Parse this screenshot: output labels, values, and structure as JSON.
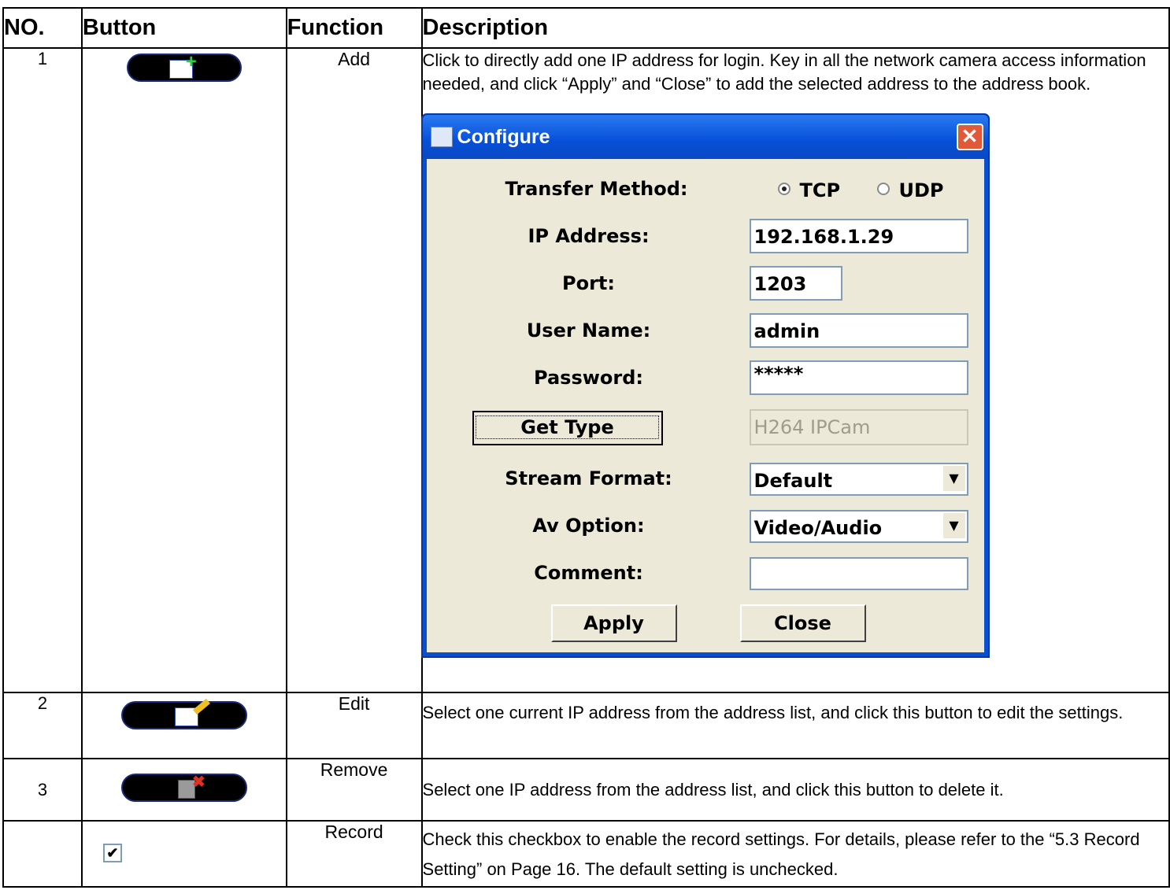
{
  "headers": {
    "no": "NO.",
    "button": "Button",
    "function": "Function",
    "description": "Description"
  },
  "rows": [
    {
      "no": "1",
      "function": "Add",
      "description": "Click to directly add one IP address for login. Key in all the network camera access information needed, and click “Apply” and “Close” to add the selected address to the address book.",
      "icon": "add-icon"
    },
    {
      "no": "2",
      "function": "Edit",
      "description": "Select one current IP address from the address list, and click this button to edit the settings.",
      "icon": "edit-icon"
    },
    {
      "no": "3",
      "function": "Remove",
      "description": "Select one IP address from the address list, and click this button to delete it.",
      "icon": "delete-icon"
    },
    {
      "no": "",
      "function": "Record",
      "description": "Check this checkbox to enable the record settings. For details, please refer to the “5.3 Record Setting” on Page 16. The default setting is unchecked.",
      "icon": "checkbox-icon"
    }
  ],
  "dialog": {
    "title": "Configure",
    "close": "✕",
    "transfer_method_label": "Transfer Method:",
    "tcp": "TCP",
    "udp": "UDP",
    "ip_label": "IP Address:",
    "ip_value": "192.168.1.29",
    "port_label": "Port:",
    "port_value": "1203",
    "user_label": "User Name:",
    "user_value": "admin",
    "password_label": "Password:",
    "password_value": "*****",
    "get_type_button": "Get Type",
    "type_value": "H264 IPCam",
    "stream_label": "Stream Format:",
    "stream_value": "Default",
    "av_label": "Av Option:",
    "av_value": "Video/Audio",
    "comment_label": "Comment:",
    "comment_value": "",
    "apply_button": "Apply",
    "close_button": "Close"
  },
  "record_checkbox": "✔"
}
